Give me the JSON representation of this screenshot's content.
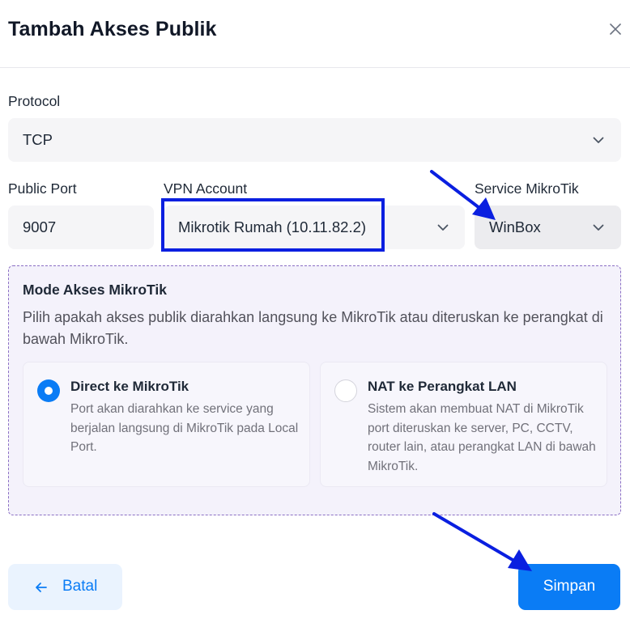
{
  "modal": {
    "title": "Tambah Akses Publik",
    "close_icon": "close-icon"
  },
  "form": {
    "protocol": {
      "label": "Protocol",
      "value": "TCP"
    },
    "public_port": {
      "label": "Public Port",
      "value": "9007"
    },
    "vpn_account": {
      "label": "VPN Account",
      "value": "Mikrotik Rumah (10.11.82.2)"
    },
    "service": {
      "label": "Service MikroTik",
      "value": "WinBox"
    }
  },
  "mode": {
    "title": "Mode Akses MikroTik",
    "description": "Pilih apakah akses publik diarahkan langsung ke MikroTik atau diteruskan ke perangkat di bawah MikroTik.",
    "options": [
      {
        "title": "Direct ke MikroTik",
        "description": "Port akan diarahkan ke service yang berjalan langsung di MikroTik pada Local Port.",
        "selected": true
      },
      {
        "title": "NAT ke Perangkat LAN",
        "description": "Sistem akan membuat NAT di MikroTik port diteruskan ke server, PC, CCTV, router lain, atau perangkat LAN di bawah MikroTik.",
        "selected": false
      }
    ]
  },
  "footer": {
    "cancel_label": "Batal",
    "save_label": "Simpan"
  },
  "colors": {
    "primary": "#0a7cf5",
    "highlight": "#0a1fe0",
    "panel_border": "#8b6fc4"
  }
}
